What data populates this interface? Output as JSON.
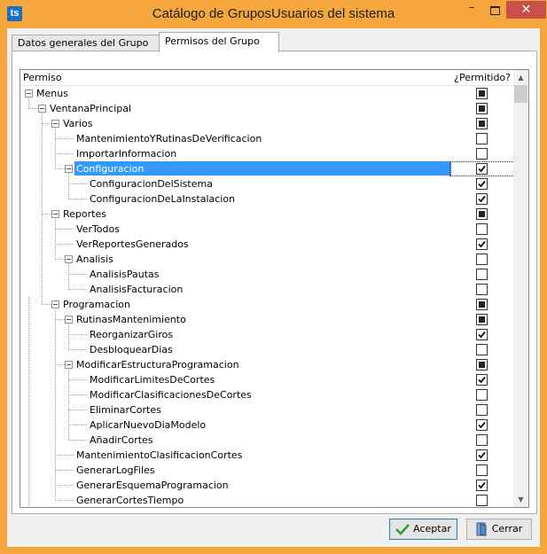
{
  "window": {
    "app_icon": "ts",
    "title": "Catálogo de GruposUsuarios del sistema",
    "minimize": "–",
    "close": "✕"
  },
  "tabs": [
    {
      "label": "Datos generales del Grupo",
      "active": false
    },
    {
      "label": "Permisos del Grupo",
      "active": true
    }
  ],
  "grid": {
    "col_permiso": "Permiso",
    "col_permitido": "¿Permitido?"
  },
  "tree": [
    {
      "label": "Menus",
      "level": 0,
      "expander": true,
      "state": "indeterminate"
    },
    {
      "label": "VentanaPrincipal",
      "level": 1,
      "expander": true,
      "state": "indeterminate"
    },
    {
      "label": "Varios",
      "level": 2,
      "expander": true,
      "state": "indeterminate"
    },
    {
      "label": "MantenimientoYRutinasDeVerificacion",
      "level": 3,
      "expander": false,
      "state": "unchecked"
    },
    {
      "label": "ImportarInformacion",
      "level": 3,
      "expander": false,
      "state": "unchecked"
    },
    {
      "label": "Configuracion",
      "level": 3,
      "expander": true,
      "state": "checked",
      "selected": true
    },
    {
      "label": "ConfiguracionDelSistema",
      "level": 4,
      "expander": false,
      "state": "checked"
    },
    {
      "label": "ConfiguracionDeLaInstalacion",
      "level": 4,
      "expander": false,
      "state": "checked"
    },
    {
      "label": "Reportes",
      "level": 2,
      "expander": true,
      "state": "indeterminate"
    },
    {
      "label": "VerTodos",
      "level": 3,
      "expander": false,
      "state": "unchecked"
    },
    {
      "label": "VerReportesGenerados",
      "level": 3,
      "expander": false,
      "state": "checked"
    },
    {
      "label": "Analisis",
      "level": 3,
      "expander": true,
      "state": "unchecked"
    },
    {
      "label": "AnalisisPautas",
      "level": 4,
      "expander": false,
      "state": "unchecked"
    },
    {
      "label": "AnalisisFacturacion",
      "level": 4,
      "expander": false,
      "state": "unchecked"
    },
    {
      "label": "Programacion",
      "level": 2,
      "expander": true,
      "state": "indeterminate"
    },
    {
      "label": "RutinasMantenimiento",
      "level": 3,
      "expander": true,
      "state": "indeterminate"
    },
    {
      "label": "ReorganizarGiros",
      "level": 4,
      "expander": false,
      "state": "checked"
    },
    {
      "label": "DesbloquearDias",
      "level": 4,
      "expander": false,
      "state": "unchecked"
    },
    {
      "label": "ModificarEstructuraProgramacion",
      "level": 3,
      "expander": true,
      "state": "indeterminate"
    },
    {
      "label": "ModificarLimitesDeCortes",
      "level": 4,
      "expander": false,
      "state": "checked"
    },
    {
      "label": "ModificarClasificacionesDeCortes",
      "level": 4,
      "expander": false,
      "state": "unchecked"
    },
    {
      "label": "EliminarCortes",
      "level": 4,
      "expander": false,
      "state": "unchecked"
    },
    {
      "label": "AplicarNuevoDiaModelo",
      "level": 4,
      "expander": false,
      "state": "checked"
    },
    {
      "label": "AñadirCortes",
      "level": 4,
      "expander": false,
      "state": "unchecked"
    },
    {
      "label": "MantenimientoClasificacionCortes",
      "level": 3,
      "expander": false,
      "state": "checked"
    },
    {
      "label": "GenerarLogFiles",
      "level": 3,
      "expander": false,
      "state": "unchecked"
    },
    {
      "label": "GenerarEsquemaProgramacion",
      "level": 3,
      "expander": false,
      "state": "checked"
    },
    {
      "label": "GenerarCortesTiempo",
      "level": 3,
      "expander": false,
      "state": "unchecked"
    }
  ],
  "buttons": {
    "accept": "Aceptar",
    "close": "Cerrar"
  },
  "colors": {
    "title_bar": "#f5a63c",
    "selection": "#3399ff",
    "close_button": "#c7504a",
    "accept_icon": "#2e9b2e"
  },
  "icons": {
    "accept": "checkmark-icon",
    "close": "door-exit-icon"
  }
}
